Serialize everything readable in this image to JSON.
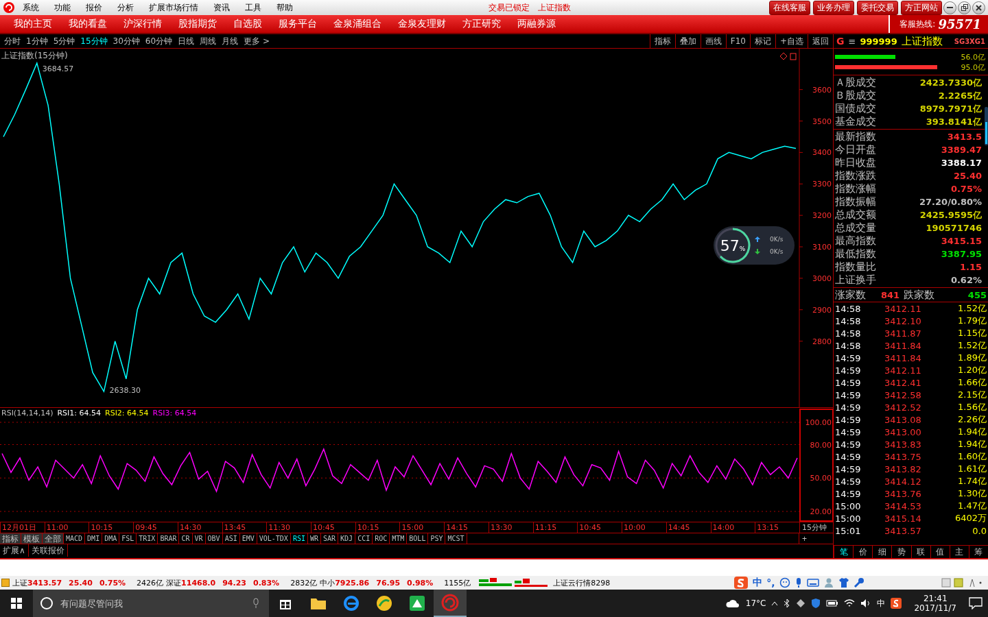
{
  "title_bar": {
    "menu": [
      "系统",
      "功能",
      "报价",
      "分析",
      "扩展市场行情",
      "资讯",
      "工具",
      "帮助"
    ],
    "status": "交易已锁定",
    "security": "上证指数",
    "buttons": [
      "在线客服",
      "业务办理",
      "委托交易",
      "方正网站"
    ]
  },
  "nav": {
    "items": [
      "我的主页",
      "我的看盘",
      "沪深行情",
      "股指期货",
      "自选股",
      "服务平台",
      "金泉涌组合",
      "金泉友理财",
      "方正研究",
      "两融券源"
    ],
    "hotline_label": "客服热线:",
    "hotline": "95571"
  },
  "periods": [
    {
      "label": "分时",
      "selected": false
    },
    {
      "label": "1分钟",
      "selected": false
    },
    {
      "label": "5分钟",
      "selected": false
    },
    {
      "label": "15分钟",
      "selected": true
    },
    {
      "label": "30分钟",
      "selected": false
    },
    {
      "label": "60分钟",
      "selected": false
    },
    {
      "label": "日线",
      "selected": false
    },
    {
      "label": "周线",
      "selected": false
    },
    {
      "label": "月线",
      "selected": false
    },
    {
      "label": "更多 >",
      "selected": false
    }
  ],
  "chart_tools": [
    "指标",
    "叠加",
    "画线",
    "F10",
    "标记",
    "+自选",
    "返回"
  ],
  "price_chart": {
    "title": "上证指数(15分钟)",
    "max_label": "3684.57",
    "min_label": "2638.30",
    "chart_data": {
      "type": "line",
      "ylim": [
        2590,
        3730
      ],
      "yticks": [
        2800,
        2900,
        3000,
        3100,
        3200,
        3300,
        3400,
        3500,
        3600
      ],
      "series": [
        {
          "color": "#00ffff",
          "values": [
            3450,
            3520,
            3600,
            3684,
            3550,
            3300,
            3000,
            2850,
            2700,
            2640,
            2800,
            2680,
            2900,
            3000,
            2950,
            3050,
            3080,
            2950,
            2880,
            2860,
            2900,
            2950,
            2870,
            3000,
            2950,
            3050,
            3100,
            3020,
            3080,
            3050,
            3000,
            3070,
            3100,
            3150,
            3200,
            3300,
            3250,
            3200,
            3100,
            3080,
            3050,
            3150,
            3100,
            3180,
            3220,
            3250,
            3240,
            3260,
            3270,
            3200,
            3100,
            3050,
            3150,
            3100,
            3120,
            3150,
            3200,
            3180,
            3220,
            3250,
            3300,
            3250,
            3280,
            3300,
            3380,
            3400,
            3390,
            3380,
            3400,
            3410,
            3420,
            3413
          ]
        }
      ]
    }
  },
  "rsi_chart": {
    "legend": [
      {
        "text": "RSI(14,14,14)",
        "color": "#c0c0c0"
      },
      {
        "text": "RSI1: 64.54",
        "color": "#ffffff"
      },
      {
        "text": "RSI2: 64.54",
        "color": "#ffff00"
      },
      {
        "text": "RSI3: 64.54",
        "color": "#ff00ff"
      }
    ],
    "chart_data": {
      "type": "line",
      "grid": true,
      "ylim": [
        20,
        100
      ],
      "yticks": [
        {
          "value": 20,
          "label": "20.00"
        },
        {
          "value": 50,
          "label": "50.00"
        },
        {
          "value": 80,
          "label": "80.00"
        },
        {
          "value": 100,
          "label": "100.00"
        }
      ],
      "series": [
        {
          "color": "#ff00ff",
          "values": [
            72,
            55,
            68,
            48,
            60,
            42,
            66,
            58,
            50,
            62,
            45,
            70,
            52,
            40,
            63,
            57,
            47,
            69,
            54,
            44,
            61,
            73,
            49,
            56,
            38,
            65,
            59,
            46,
            71,
            53,
            41,
            64,
            50,
            67,
            43,
            58,
            76,
            52,
            45,
            62,
            55,
            48,
            66,
            39,
            60,
            51,
            70,
            57,
            44,
            63,
            49,
            68,
            54,
            42,
            61,
            58,
            47,
            72,
            50,
            40,
            65,
            56,
            46,
            69,
            53,
            43,
            62,
            59,
            48,
            74,
            51,
            45,
            66,
            57,
            41,
            63,
            52,
            70,
            55,
            46,
            61,
            49,
            67,
            58,
            44,
            64,
            53,
            60,
            50,
            68
          ]
        }
      ]
    }
  },
  "time_axis": [
    "12月01日",
    "11:00",
    "10:15",
    "09:45",
    "14:30",
    "13:45",
    "11:30",
    "10:45",
    "10:15",
    "15:00",
    "14:15",
    "13:30",
    "11:15",
    "10:45",
    "10:00",
    "14:45",
    "14:00",
    "13:15"
  ],
  "period_label": "15分钟",
  "indicator_tabs": [
    {
      "label": "指标",
      "selected": false
    },
    {
      "label": "模板",
      "selected": false
    },
    {
      "label": "全部",
      "selected": false
    },
    {
      "label": "MACD",
      "selected": false
    },
    {
      "label": "DMI",
      "selected": false
    },
    {
      "label": "DMA",
      "selected": false
    },
    {
      "label": "FSL",
      "selected": false
    },
    {
      "label": "TRIX",
      "selected": false
    },
    {
      "label": "BRAR",
      "selected": false
    },
    {
      "label": "CR",
      "selected": false
    },
    {
      "label": "VR",
      "selected": false
    },
    {
      "label": "OBV",
      "selected": false
    },
    {
      "label": "ASI",
      "selected": false
    },
    {
      "label": "EMV",
      "selected": false
    },
    {
      "label": "VOL-TDX",
      "selected": false
    },
    {
      "label": "RSI",
      "selected": true
    },
    {
      "label": "WR",
      "selected": false
    },
    {
      "label": "SAR",
      "selected": false
    },
    {
      "label": "KDJ",
      "selected": false
    },
    {
      "label": "CCI",
      "selected": false
    },
    {
      "label": "ROC",
      "selected": false
    },
    {
      "label": "MTM",
      "selected": false
    },
    {
      "label": "BOLL",
      "selected": false
    },
    {
      "label": "PSY",
      "selected": false
    },
    {
      "label": "MCST",
      "selected": false
    }
  ],
  "add_button": "+",
  "bottom_tabs": [
    "扩展∧",
    "关联报价"
  ],
  "quote_panel": {
    "marker": "G",
    "menu": "≡",
    "code": "999999",
    "name": "上证指数",
    "tags": "SG3XG1",
    "volume_bars": [
      {
        "level": 0.4,
        "reading": "56.0亿",
        "color": "#00e000"
      },
      {
        "level": 0.68,
        "reading": "95.0亿",
        "color": "#ff3030"
      }
    ],
    "turnover": [
      {
        "label": "Ａ股成交",
        "value": "2423.7330亿",
        "color": "#d4d400"
      },
      {
        "label": "Ｂ股成交",
        "value": "2.2265亿",
        "color": "#d4d400"
      },
      {
        "label": "国债成交",
        "value": "8979.7971亿",
        "color": "#d4d400"
      },
      {
        "label": "基金成交",
        "value": "393.8141亿",
        "color": "#d4d400"
      }
    ],
    "stats": [
      {
        "label": "最新指数",
        "value": "3413.5",
        "color": "#ff3030"
      },
      {
        "label": "今日开盘",
        "value": "3389.47",
        "color": "#ff3030"
      },
      {
        "label": "昨日收盘",
        "value": "3388.17",
        "color": "#ffffff"
      },
      {
        "label": "指数涨跌",
        "value": "25.40",
        "color": "#ff3030"
      },
      {
        "label": "指数涨幅",
        "value": "0.75%",
        "color": "#ff3030"
      },
      {
        "label": "指数振幅",
        "value": "27.20/0.80%",
        "color": "#c0c0c0"
      },
      {
        "label": "总成交额",
        "value": "2425.9595亿",
        "color": "#d4d400"
      },
      {
        "label": "总成交量",
        "value": "190571746",
        "color": "#d4d400"
      },
      {
        "label": "最高指数",
        "value": "3415.15",
        "color": "#ff3030"
      },
      {
        "label": "最低指数",
        "value": "3387.95",
        "color": "#00e000"
      },
      {
        "label": "指数量比",
        "value": "1.15",
        "color": "#ff3030"
      },
      {
        "label": "上证换手",
        "value": "0.62%",
        "color": "#c0c0c0"
      }
    ],
    "breadth": {
      "up_label": "涨家数",
      "up": "841",
      "down_label": "跌家数",
      "down": "455"
    },
    "ticks": [
      {
        "time": "14:58",
        "price": "3412.11",
        "amount": "1.52亿"
      },
      {
        "time": "14:58",
        "price": "3412.10",
        "amount": "1.79亿"
      },
      {
        "time": "14:58",
        "price": "3411.87",
        "amount": "1.15亿"
      },
      {
        "time": "14:58",
        "price": "3411.84",
        "amount": "1.52亿"
      },
      {
        "time": "14:59",
        "price": "3411.84",
        "amount": "1.89亿"
      },
      {
        "time": "14:59",
        "price": "3412.11",
        "amount": "1.20亿"
      },
      {
        "time": "14:59",
        "price": "3412.41",
        "amount": "1.66亿"
      },
      {
        "time": "14:59",
        "price": "3412.58",
        "amount": "2.15亿"
      },
      {
        "time": "14:59",
        "price": "3412.52",
        "amount": "1.56亿"
      },
      {
        "time": "14:59",
        "price": "3413.08",
        "amount": "2.26亿"
      },
      {
        "time": "14:59",
        "price": "3413.00",
        "amount": "1.94亿"
      },
      {
        "time": "14:59",
        "price": "3413.83",
        "amount": "1.94亿"
      },
      {
        "time": "14:59",
        "price": "3413.75",
        "amount": "1.60亿"
      },
      {
        "time": "14:59",
        "price": "3413.82",
        "amount": "1.61亿"
      },
      {
        "time": "14:59",
        "price": "3414.12",
        "amount": "1.74亿"
      },
      {
        "time": "14:59",
        "price": "3413.76",
        "amount": "1.30亿"
      },
      {
        "time": "15:00",
        "price": "3414.53",
        "amount": "1.47亿"
      },
      {
        "time": "15:00",
        "price": "3415.14",
        "amount": "6402万"
      },
      {
        "time": "15:01",
        "price": "3413.57",
        "amount": "0.0"
      }
    ],
    "tabs": [
      {
        "label": "笔",
        "selected": true
      },
      {
        "label": "价",
        "selected": false
      },
      {
        "label": "细",
        "selected": false
      },
      {
        "label": "势",
        "selected": false
      },
      {
        "label": "联",
        "selected": false
      },
      {
        "label": "值",
        "selected": false
      },
      {
        "label": "主",
        "selected": false
      },
      {
        "label": "筹",
        "selected": false
      }
    ]
  },
  "speed_widget": {
    "percent": "57",
    "unit": "%",
    "up": "0K/s",
    "down": "0K/s"
  },
  "status_bar": {
    "indices": [
      {
        "name": "上证",
        "value": "3413.57",
        "change": "25.40",
        "pct": "0.75%",
        "amount": "2426亿"
      },
      {
        "name": "深证",
        "value": "11468.0",
        "change": "94.23",
        "pct": "0.83%",
        "amount": "2832亿"
      },
      {
        "name": "中小",
        "value": "7925.86",
        "change": "76.95",
        "pct": "0.98%",
        "amount": "1155亿"
      }
    ],
    "cloud": "上证云行情8298",
    "ime": [
      "中",
      "°,"
    ]
  },
  "taskbar": {
    "search_placeholder": "有问题尽管问我",
    "weather": "17°C",
    "ime": "中",
    "time": "21:41",
    "date": "2017/11/7"
  }
}
